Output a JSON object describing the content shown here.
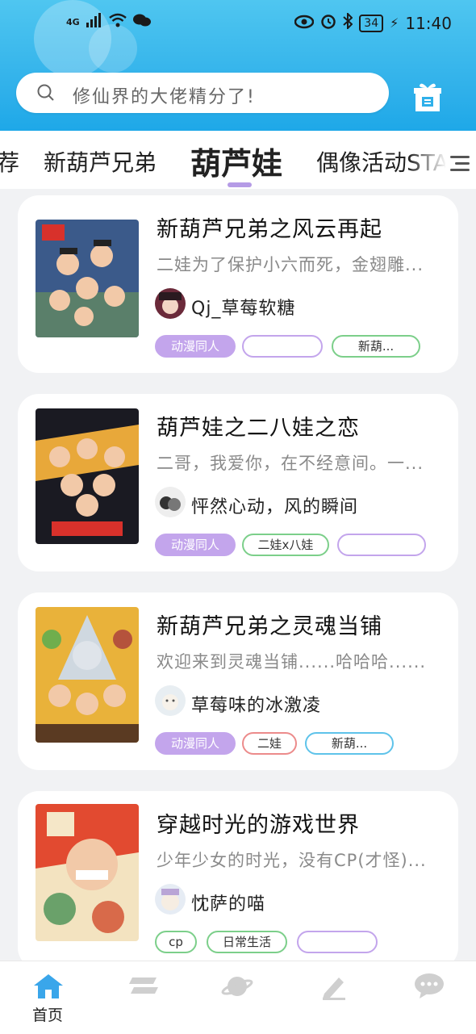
{
  "status": {
    "network": "4G",
    "battery": "34",
    "time": "11:40"
  },
  "search": {
    "placeholder": "修仙界的大佬精分了!"
  },
  "tabs": [
    {
      "label": "荐"
    },
    {
      "label": "新葫芦兄弟"
    },
    {
      "label": "葫芦娃"
    },
    {
      "label": "偶像活动STA"
    }
  ],
  "cards": [
    {
      "title": "新葫芦兄弟之风云再起",
      "desc": "二娃为了保护小六而死，金翅雕...",
      "author": "Qj_草莓软糖",
      "tags": [
        "动漫同人",
        "",
        "新葫..."
      ]
    },
    {
      "title": "葫芦娃之二八娃之恋",
      "desc": "二哥，我爱你，在不经意间。一...",
      "author": "怦然心动，风的瞬间",
      "tags": [
        "动漫同人",
        "二娃x八娃",
        ""
      ]
    },
    {
      "title": "新葫芦兄弟之灵魂当铺",
      "desc": "欢迎来到灵魂当铺......哈哈哈......",
      "author": "草莓味的冰激凌",
      "tags": [
        "动漫同人",
        "二娃",
        "新葫..."
      ]
    },
    {
      "title": "穿越时光的游戏世界",
      "desc": "少年少女的时光，没有CP(才怪)...",
      "author": "忱萨的喵",
      "tags": [
        "cp",
        "日常生活",
        ""
      ]
    }
  ],
  "bottom_nav": {
    "home_label": "首页"
  },
  "colors": {
    "header": "#2fb0ea",
    "accent": "#c3a5ec",
    "tab_indicator": "#b59be6"
  }
}
